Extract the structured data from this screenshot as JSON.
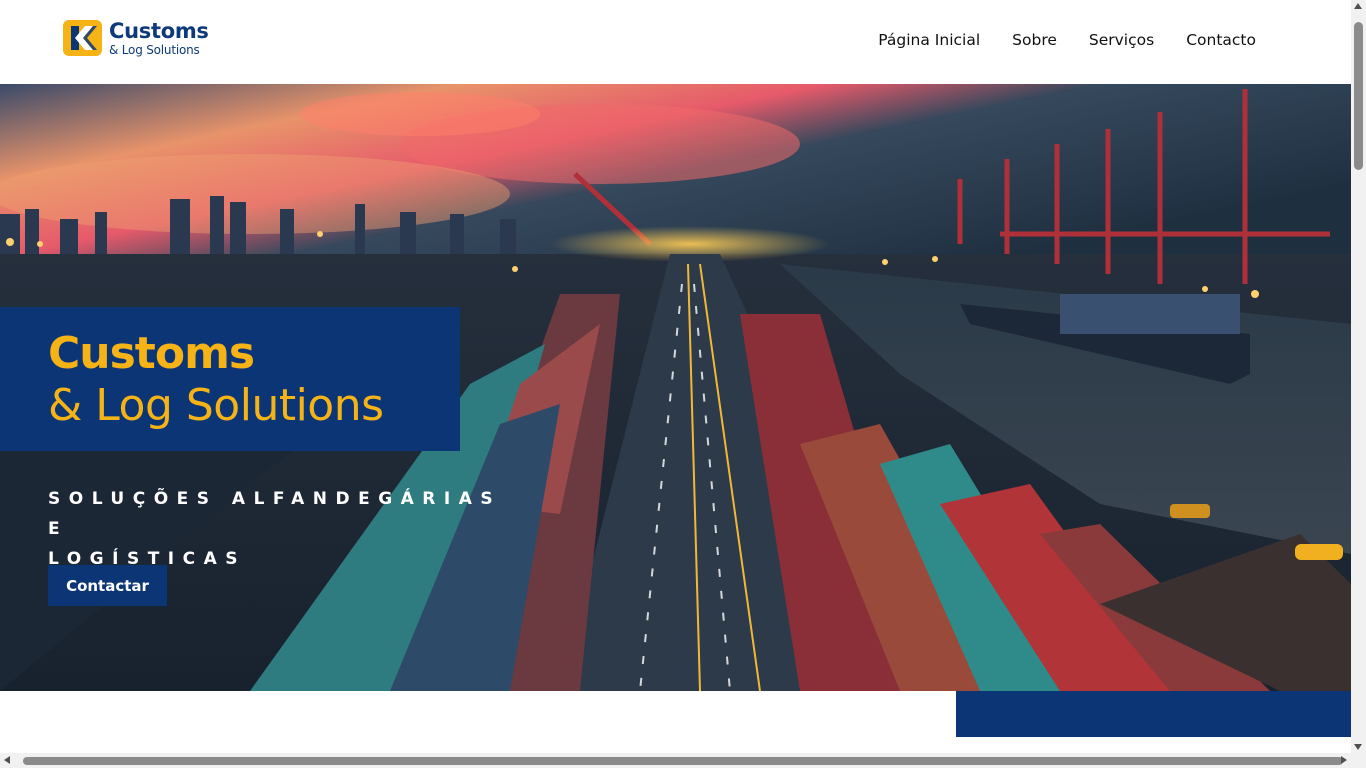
{
  "header": {
    "logo": {
      "title": "Customs",
      "subtitle": "& Log Solutions",
      "icon": "chevron-left-logo-icon",
      "accent": "#f5b316"
    },
    "nav": [
      {
        "label": "Página Inicial"
      },
      {
        "label": "Sobre"
      },
      {
        "label": "Serviços"
      },
      {
        "label": "Contacto"
      }
    ]
  },
  "hero": {
    "background": "port-containers-sunset-image",
    "title_line1": "Customs",
    "title_line2": "& Log Solutions",
    "tagline_line1": "SOLUÇÕES ALFANDEGÁRIAS E",
    "tagline_line2": "LOGÍSTICAS",
    "cta_label": "Contactar"
  },
  "colors": {
    "brand_blue": "#0c3576",
    "brand_yellow": "#f5b316"
  }
}
